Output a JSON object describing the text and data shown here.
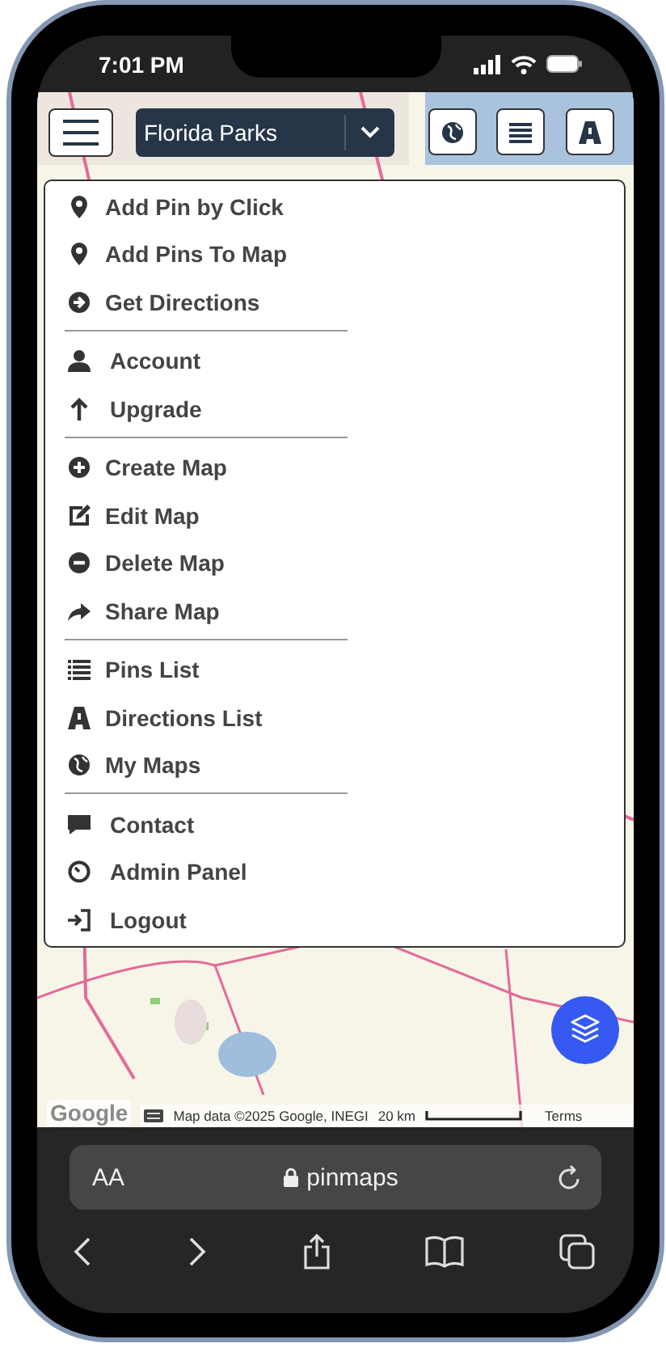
{
  "status_bar": {
    "time": "7:01 PM"
  },
  "map_controls": {
    "map_select": {
      "value": "Florida Parks"
    }
  },
  "menu": {
    "groups": [
      {
        "items": [
          {
            "label": "Add Pin by Click"
          },
          {
            "label": "Add Pins To Map"
          },
          {
            "label": "Get Directions"
          }
        ]
      },
      {
        "items": [
          {
            "label": "Account"
          },
          {
            "label": "Upgrade"
          }
        ]
      },
      {
        "items": [
          {
            "label": "Create Map"
          },
          {
            "label": "Edit Map"
          },
          {
            "label": "Delete Map"
          },
          {
            "label": "Share Map"
          }
        ]
      },
      {
        "items": [
          {
            "label": "Pins List"
          },
          {
            "label": "Directions List"
          },
          {
            "label": "My Maps"
          }
        ]
      },
      {
        "items": [
          {
            "label": "Contact"
          },
          {
            "label": "Admin Panel"
          },
          {
            "label": "Logout"
          }
        ]
      }
    ]
  },
  "map_footer": {
    "logo": "Google",
    "attribution": "Map data ©2025 Google, INEGI",
    "scale": "20 km",
    "terms": "Terms"
  },
  "browser": {
    "text_size": "AA",
    "url": "pinmaps"
  }
}
